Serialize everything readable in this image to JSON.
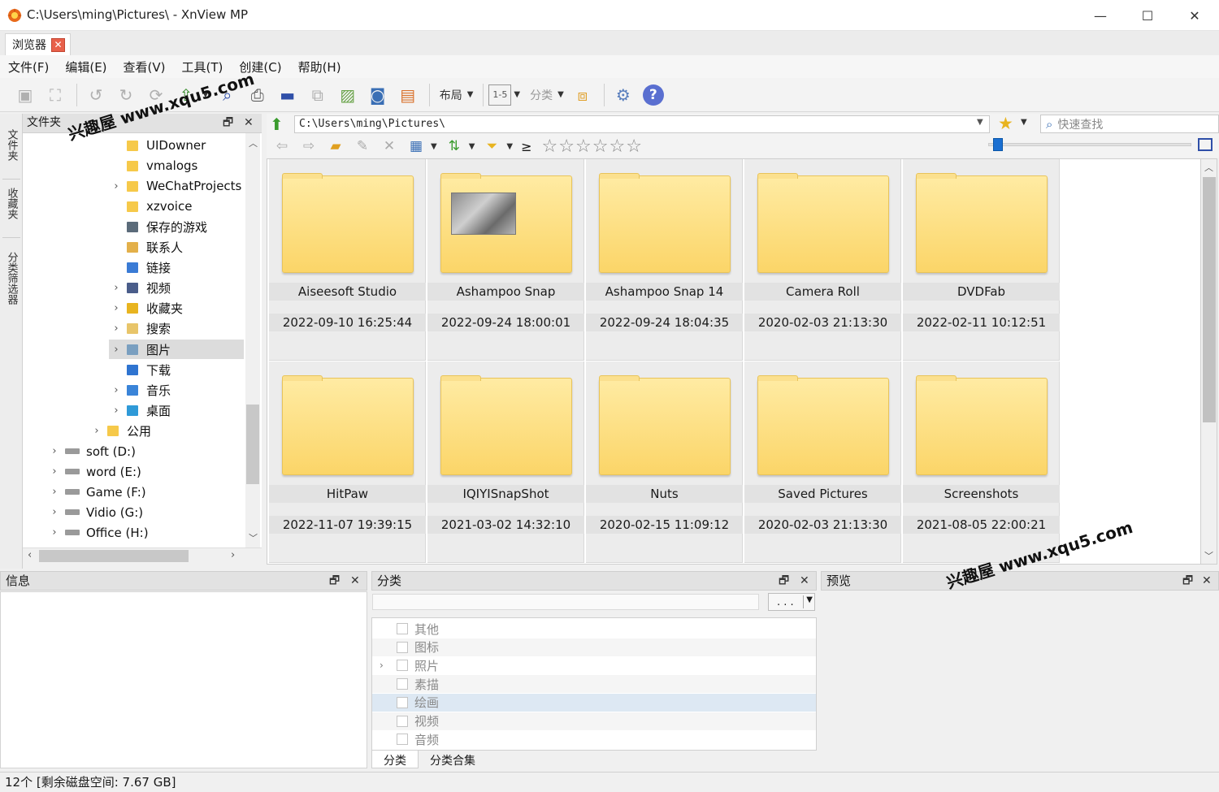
{
  "window": {
    "title": "C:\\Users\\ming\\Pictures\\ - XnView MP",
    "minimize": "—",
    "maximize": "☐",
    "close": "✕"
  },
  "tabs": [
    {
      "label": "浏览器",
      "close": "✕"
    }
  ],
  "menu": [
    "文件(F)",
    "编辑(E)",
    "查看(V)",
    "工具(T)",
    "创建(C)",
    "帮助(H)"
  ],
  "toolbar": {
    "layout_label": "布局",
    "range_label": "1-5",
    "category_label": "分类",
    "help_label": "?"
  },
  "side_tabs": [
    "文件夹",
    "收藏夹",
    "分类筛选器"
  ],
  "folder_panel": {
    "title": "文件夹",
    "restore_icon": "🗗",
    "close_icon": "✕",
    "tree": [
      {
        "label": "UIDowner",
        "expandable": false,
        "level": 2,
        "icon": "folder"
      },
      {
        "label": "vmalogs",
        "expandable": false,
        "level": 2,
        "icon": "folder"
      },
      {
        "label": "WeChatProjects",
        "expandable": true,
        "level": 2,
        "icon": "folder"
      },
      {
        "label": "xzvoice",
        "expandable": false,
        "level": 2,
        "icon": "folder"
      },
      {
        "label": "保存的游戏",
        "expandable": false,
        "level": 2,
        "icon": "games-folder"
      },
      {
        "label": "联系人",
        "expandable": false,
        "level": 2,
        "icon": "contacts-folder"
      },
      {
        "label": "链接",
        "expandable": false,
        "level": 2,
        "icon": "links-folder"
      },
      {
        "label": "视频",
        "expandable": true,
        "level": 2,
        "icon": "videos-folder"
      },
      {
        "label": "收藏夹",
        "expandable": true,
        "level": 2,
        "icon": "favorites-folder"
      },
      {
        "label": "搜索",
        "expandable": true,
        "level": 2,
        "icon": "search-folder"
      },
      {
        "label": "图片",
        "expandable": true,
        "level": 2,
        "icon": "pictures-folder",
        "selected": true
      },
      {
        "label": "下载",
        "expandable": false,
        "level": 2,
        "icon": "downloads-folder"
      },
      {
        "label": "音乐",
        "expandable": true,
        "level": 2,
        "icon": "music-folder"
      },
      {
        "label": "桌面",
        "expandable": true,
        "level": 2,
        "icon": "desktop-folder"
      },
      {
        "label": "公用",
        "expandable": true,
        "level": 1,
        "icon": "folder"
      },
      {
        "label": "soft (D:)",
        "expandable": true,
        "level": 0,
        "icon": "drive"
      },
      {
        "label": "word (E:)",
        "expandable": true,
        "level": 0,
        "icon": "drive"
      },
      {
        "label": "Game (F:)",
        "expandable": true,
        "level": 0,
        "icon": "drive"
      },
      {
        "label": "Vidio (G:)",
        "expandable": true,
        "level": 0,
        "icon": "drive"
      },
      {
        "label": "Office (H:)",
        "expandable": true,
        "level": 0,
        "icon": "drive"
      }
    ]
  },
  "address": {
    "path": "C:\\Users\\ming\\Pictures\\",
    "search_placeholder": "快速查找"
  },
  "filter_symbol": "≥",
  "thumbnails": [
    {
      "name": "Aiseesoft Studio",
      "date": "2022-09-10 16:25:44",
      "has_photo": false
    },
    {
      "name": "Ashampoo Snap",
      "date": "2022-09-24 18:00:01",
      "has_photo": true
    },
    {
      "name": "Ashampoo Snap 14",
      "date": "2022-09-24 18:04:35",
      "has_photo": false
    },
    {
      "name": "Camera Roll",
      "date": "2020-02-03 21:13:30",
      "has_photo": false
    },
    {
      "name": "DVDFab",
      "date": "2022-02-11 10:12:51",
      "has_photo": false
    },
    {
      "name": "HitPaw",
      "date": "2022-11-07 19:39:15",
      "has_photo": false
    },
    {
      "name": "IQIYISnapShot",
      "date": "2021-03-02 14:32:10",
      "has_photo": false
    },
    {
      "name": "Nuts",
      "date": "2020-02-15 11:09:12",
      "has_photo": false
    },
    {
      "name": "Saved Pictures",
      "date": "2020-02-03 21:13:30",
      "has_photo": false
    },
    {
      "name": "Screenshots",
      "date": "2021-08-05 22:00:21",
      "has_photo": false
    }
  ],
  "info_panel": {
    "title": "信息"
  },
  "category_panel": {
    "title": "分类",
    "more_button": ". . .",
    "items": [
      {
        "label": "其他",
        "expandable": false
      },
      {
        "label": "图标",
        "expandable": false
      },
      {
        "label": "照片",
        "expandable": true
      },
      {
        "label": "素描",
        "expandable": false
      },
      {
        "label": "绘画",
        "expandable": false,
        "selected": true
      },
      {
        "label": "视频",
        "expandable": false
      },
      {
        "label": "音频",
        "expandable": false
      }
    ],
    "tabs": [
      "分类",
      "分类合集"
    ]
  },
  "preview_panel": {
    "title": "预览"
  },
  "status": "12个 [剩余磁盘空间: 7.67 GB]",
  "watermark": "兴趣屋 www.xqu5.com",
  "colors": {
    "accent": "#1a6fd1",
    "folder": "#fbd568",
    "tab_close": "#e8604a"
  }
}
